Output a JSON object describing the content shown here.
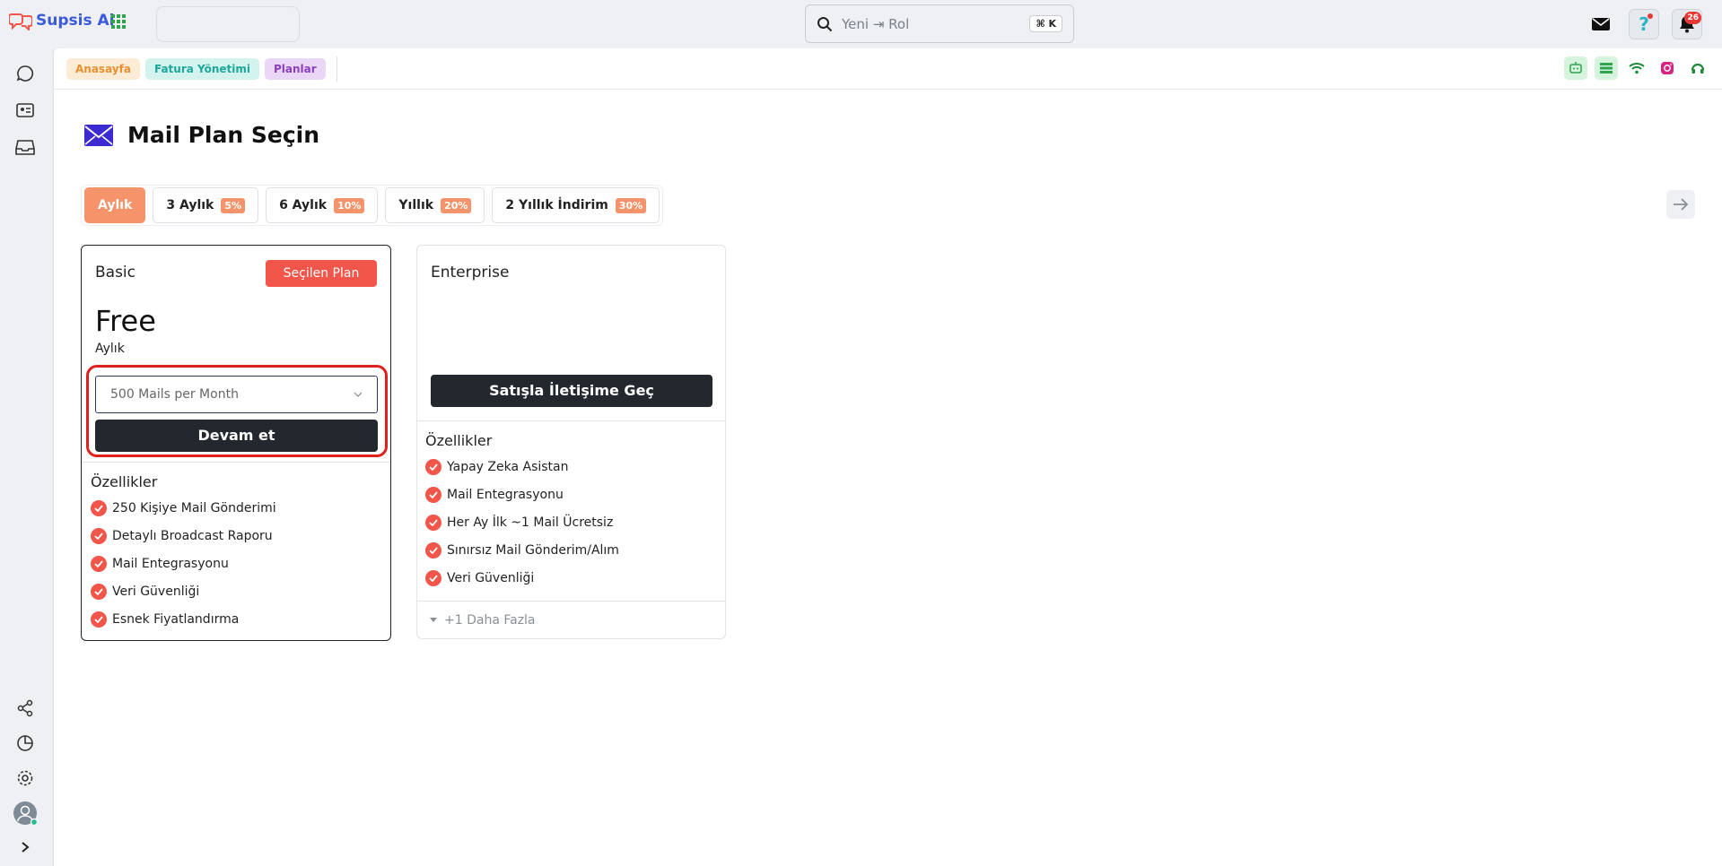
{
  "app": {
    "name": "Supsis Ai"
  },
  "search": {
    "placeholder": "Yeni ⇥ Rol",
    "shortcut": "⌘ K"
  },
  "notifications": {
    "count": "26"
  },
  "breadcrumbs": [
    "Anasayfa",
    "Fatura Yönetimi",
    "Planlar"
  ],
  "page": {
    "title": "Mail Plan Seçin"
  },
  "period_tabs": [
    {
      "label": "Aylık",
      "discount": "",
      "active": true
    },
    {
      "label": "3 Aylık",
      "discount": "5%"
    },
    {
      "label": "6 Aylık",
      "discount": "10%"
    },
    {
      "label": "Yıllık",
      "discount": "20%"
    },
    {
      "label": "2 Yıllık İndirim",
      "discount": "30%"
    }
  ],
  "plans": {
    "basic": {
      "name": "Basic",
      "selected_label": "Seçilen Plan",
      "price": "Free",
      "period": "Aylık",
      "select_value": "500 Mails per Month",
      "cta": "Devam et",
      "features_title": "Özellikler",
      "features": [
        "250 Kişiye Mail Gönderimi",
        "Detaylı Broadcast Raporu",
        "Mail Entegrasyonu",
        "Veri Güvenliği",
        "Esnek Fiyatlandırma"
      ]
    },
    "enterprise": {
      "name": "Enterprise",
      "cta": "Satışla İletişime Geç",
      "features_title": "Özellikler",
      "features": [
        "Yapay Zeka Asistan",
        "Mail Entegrasyonu",
        "Her Ay İlk ~1 Mail Ücretsiz",
        "Sınırsız Mail Gönderim/Alım",
        "Veri Güvenliği"
      ],
      "more": "+1 Daha Fazla"
    }
  },
  "colors": {
    "accent": "#f5946a",
    "danger": "#f2554a",
    "dark": "#23272e",
    "brand": "#3a5bd9"
  }
}
